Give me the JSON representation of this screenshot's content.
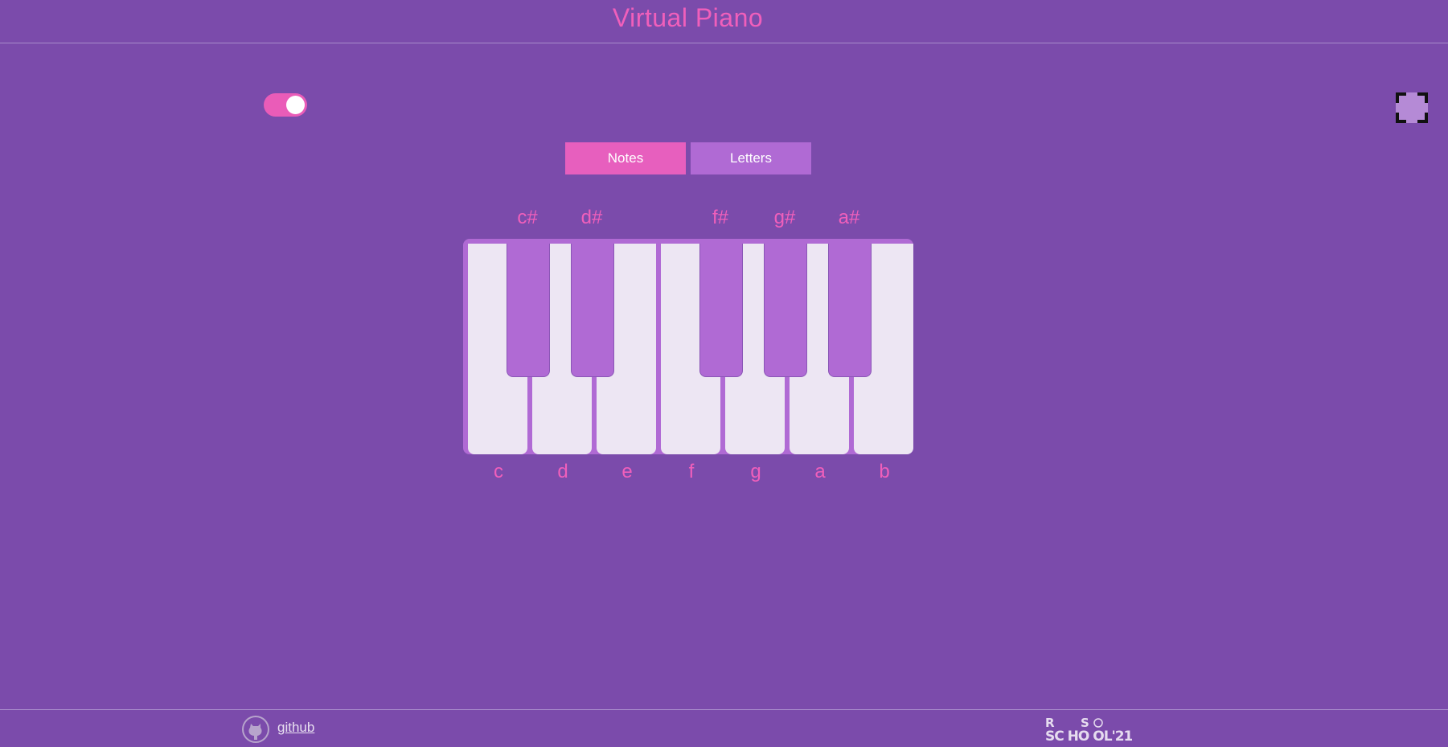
{
  "header": {
    "title": "Virtual Piano"
  },
  "toggle": {
    "state": "on"
  },
  "fullscreen": {
    "icon": "fullscreen-icon"
  },
  "switch": {
    "notes_label": "Notes",
    "letters_label": "Letters",
    "active": "Notes"
  },
  "piano": {
    "white_keys": [
      "c",
      "d",
      "e",
      "f",
      "g",
      "a",
      "b"
    ],
    "black_keys": [
      "c#",
      "d#",
      "f#",
      "g#",
      "a#"
    ]
  },
  "footer": {
    "github_label": "github",
    "github_icon": "github-icon",
    "logo_text": "RS SCHOOL'21"
  },
  "colors": {
    "background": "#7b4bab",
    "accent_pink": "#e75fbe",
    "accent_purple": "#b06ad4",
    "white_key": "#ede6f3"
  }
}
